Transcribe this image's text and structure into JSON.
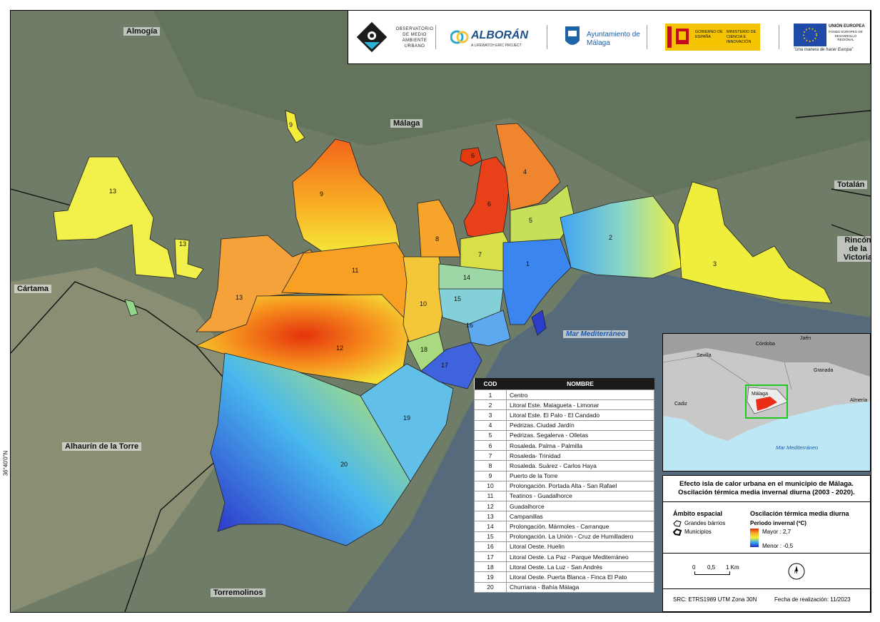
{
  "places": {
    "almogia": "Almogía",
    "malaga": "Málaga",
    "totalan": "Totalán",
    "rincon": "Rincón de la Victoria",
    "cartama": "Cártama",
    "alhaurin": "Alhaurín de la Torre",
    "torremolinos": "Torremolinos",
    "sea": "Mar Mediterráneo"
  },
  "coord_label": "36°40'0\"N",
  "logos": {
    "omau": "OBSERVATORIO DE MEDIO AMBIENTE URBANO",
    "alboran": "ALBORÁN",
    "alboran_sub": "A LIFEWATCH ERIC PROJECT",
    "ayto": "Ayuntamiento de Málaga",
    "gobierno": "GOBIERNO DE ESPAÑA",
    "ministerio": "MINISTERIO DE CIENCIA E INNOVACIÓN",
    "ue": "UNIÓN EUROPEA",
    "fondo": "FONDO EUROPEO DE DESARROLLO REGIONAL",
    "ue_motto": "\"Una manera de hacer Europa\""
  },
  "district_numbers": [
    "1",
    "2",
    "3",
    "4",
    "5",
    "6",
    "6",
    "7",
    "8",
    "9",
    "9",
    "10",
    "11",
    "12",
    "13",
    "13",
    "13",
    "14",
    "15",
    "16",
    "17",
    "18",
    "19",
    "20"
  ],
  "legend_table": {
    "header_cod": "COD",
    "header_nombre": "NOMBRE",
    "rows": [
      {
        "cod": "1",
        "nombre": "Centro"
      },
      {
        "cod": "2",
        "nombre": "Litoral Este. Malagueta - Limonar"
      },
      {
        "cod": "3",
        "nombre": "Litoral Este. El Palo - El Candado"
      },
      {
        "cod": "4",
        "nombre": "Pedrizas. Ciudad Jardín"
      },
      {
        "cod": "5",
        "nombre": "Pedrizas. Segalerva - Olletas"
      },
      {
        "cod": "6",
        "nombre": "Rosaleda. Palma - Palmilla"
      },
      {
        "cod": "7",
        "nombre": "Rosaleda- Trinidad"
      },
      {
        "cod": "8",
        "nombre": "Rosaleda. Suárez - Carlos Haya"
      },
      {
        "cod": "9",
        "nombre": "Puerto de la Torre"
      },
      {
        "cod": "10",
        "nombre": "Prolongación. Portada Alta - San Rafael"
      },
      {
        "cod": "11",
        "nombre": "Teatinos - Guadalhorce"
      },
      {
        "cod": "12",
        "nombre": "Guadalhorce"
      },
      {
        "cod": "13",
        "nombre": "Campanillas"
      },
      {
        "cod": "14",
        "nombre": "Prolongación. Mármoles - Carranque"
      },
      {
        "cod": "15",
        "nombre": "Prolongación. La Unión - Cruz de Humilladero"
      },
      {
        "cod": "16",
        "nombre": "Litoral Oeste. Huelin"
      },
      {
        "cod": "17",
        "nombre": "Litoral Oeste. La Paz - Parque Mediterráneo"
      },
      {
        "cod": "18",
        "nombre": "Litoral Oeste. La Luz - San Andrés"
      },
      {
        "cod": "19",
        "nombre": "Litoral Oeste. Puerta Blanca - Finca El Pato"
      },
      {
        "cod": "20",
        "nombre": "Churriana - Bahía Málaga"
      }
    ]
  },
  "inset": {
    "places": [
      "Córdoba",
      "Jaén",
      "Sevilla",
      "Granada",
      "Cadiz",
      "Almería",
      "Málaga"
    ],
    "sea": "Mar Mediterráneo"
  },
  "title": "Efecto isla de calor urbana en el municipio de Málaga. Oscilación térmica media invernal diurna (2003 - 2020).",
  "legend": {
    "ambito_title": "Ámbito espacial",
    "grandes_barrios": "Grandes bárrios",
    "municipios": "Municipios",
    "oscilacion_title": "Oscilación térmica media diurna",
    "periodo": "Periodo invernal (ºC)",
    "mayor": "Mayor : 2,7",
    "menor": "Menor : -0,5"
  },
  "scale": {
    "ticks": [
      "0",
      "0,5",
      "1 Km"
    ]
  },
  "north": "N",
  "src": "SRC: ETRS1989 UTM Zona 30N",
  "fecha": "Fecha de realización: 11/2023",
  "colors": {
    "hot": "#e52a0b",
    "warm": "#fca61e",
    "mid": "#f7f03a",
    "cool": "#2a8ff2",
    "cold": "#2c24c8",
    "terrain": "#6f7f6a",
    "sea": "#536a7c"
  }
}
